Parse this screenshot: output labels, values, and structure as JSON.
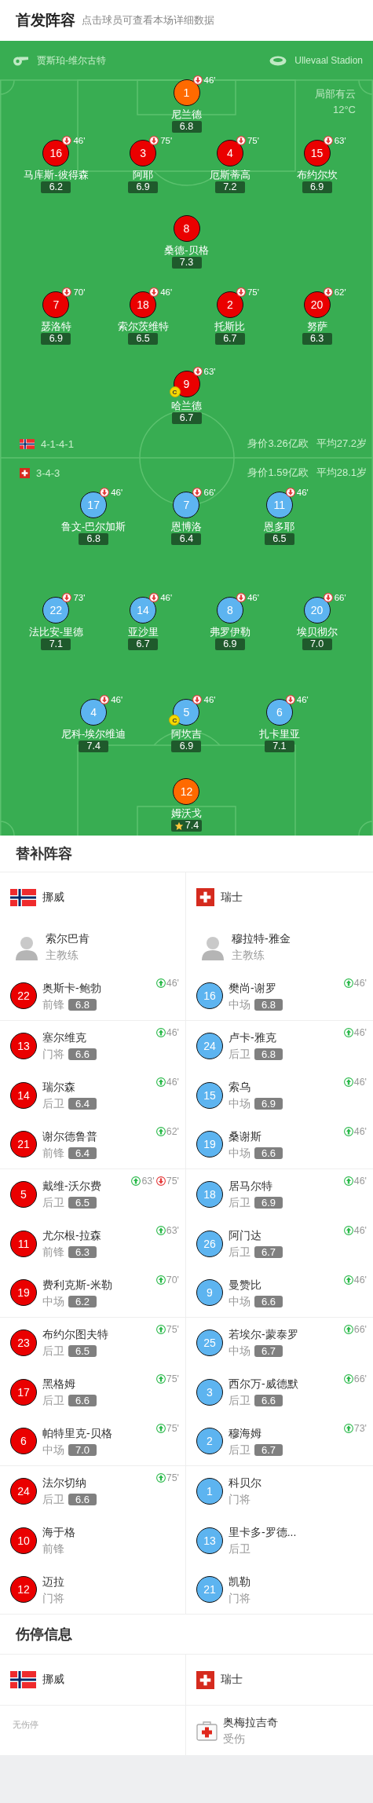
{
  "header": {
    "title": "首发阵容",
    "hint": "点击球员可查看本场详细数据"
  },
  "pitch": {
    "referee": "贾斯珀-维尔古特",
    "stadium": "Ullevaal Stadion",
    "weather": "局部有云",
    "temperature": "12°C",
    "home_rows": [
      [
        {
          "number": "1",
          "name": "尼兰德",
          "rating": "6.8",
          "off": "46'",
          "color": "#ff6a00",
          "best": false
        }
      ],
      [
        {
          "number": "16",
          "name": "马库斯-彼得森",
          "rating": "6.2",
          "off": "46'",
          "color": "#ea0000",
          "best": false
        },
        {
          "number": "3",
          "name": "阿耶",
          "rating": "6.9",
          "off": "75'",
          "color": "#ea0000",
          "best": false
        },
        {
          "number": "4",
          "name": "厄斯蒂高",
          "rating": "7.2",
          "off": "75'",
          "color": "#ea0000",
          "best": false
        },
        {
          "number": "15",
          "name": "布约尔坎",
          "rating": "6.9",
          "off": "63'",
          "color": "#ea0000",
          "best": false
        }
      ],
      [
        {
          "number": "8",
          "name": "桑德-贝格",
          "rating": "7.3",
          "color": "#ea0000",
          "best": false
        }
      ],
      [
        {
          "number": "7",
          "name": "瑟洛特",
          "rating": "6.9",
          "off": "70'",
          "color": "#ea0000",
          "best": false
        },
        {
          "number": "18",
          "name": "索尔茨维特",
          "rating": "6.5",
          "off": "46'",
          "color": "#ea0000",
          "best": false
        },
        {
          "number": "2",
          "name": "托斯比",
          "rating": "6.7",
          "off": "75'",
          "color": "#ea0000",
          "best": false
        },
        {
          "number": "20",
          "name": "努萨",
          "rating": "6.3",
          "off": "62'",
          "color": "#ea0000",
          "best": false
        }
      ],
      [
        {
          "number": "9",
          "name": "哈兰德",
          "rating": "6.7",
          "off": "63'",
          "captain": "C",
          "color": "#ea0000",
          "best": false
        }
      ]
    ],
    "formations": [
      {
        "formation": "4-1-4-1",
        "value": "身价3.26亿欧",
        "age": "平均27.2岁"
      },
      {
        "formation": "3-4-3",
        "value": "身价1.59亿欧",
        "age": "平均28.1岁"
      }
    ],
    "away_rows": [
      [
        {
          "number": "17",
          "name": "鲁文-巴尔加斯",
          "rating": "6.8",
          "off": "46'",
          "color": "#5db4f0",
          "best": false
        },
        {
          "number": "7",
          "name": "恩博洛",
          "rating": "6.4",
          "off": "66'",
          "color": "#5db4f0",
          "best": false
        },
        {
          "number": "11",
          "name": "恩多耶",
          "rating": "6.5",
          "off": "46'",
          "color": "#5db4f0",
          "best": false
        }
      ],
      [
        {
          "number": "22",
          "name": "法比安-里德",
          "rating": "7.1",
          "off": "73'",
          "color": "#5db4f0",
          "best": false
        },
        {
          "number": "14",
          "name": "亚沙里",
          "rating": "6.7",
          "off": "46'",
          "color": "#5db4f0",
          "best": false
        },
        {
          "number": "8",
          "name": "弗罗伊勒",
          "rating": "6.9",
          "off": "46'",
          "color": "#5db4f0",
          "best": false
        },
        {
          "number": "20",
          "name": "埃贝彻尔",
          "rating": "7.0",
          "off": "66'",
          "color": "#5db4f0",
          "best": false
        }
      ],
      [
        {
          "number": "4",
          "name": "尼科-埃尔维迪",
          "rating": "7.4",
          "off": "46'",
          "color": "#5db4f0",
          "best": false
        },
        {
          "number": "5",
          "name": "阿坎吉",
          "rating": "6.9",
          "off": "46'",
          "captain": "C",
          "color": "#5db4f0",
          "best": false
        },
        {
          "number": "6",
          "name": "扎卡里亚",
          "rating": "7.1",
          "off": "46'",
          "color": "#5db4f0",
          "best": false
        }
      ],
      [
        {
          "number": "12",
          "name": "姆沃戈",
          "rating": "7.4",
          "color": "#ff6a00",
          "best": true
        }
      ]
    ]
  },
  "bench": {
    "title": "替补阵容",
    "teams": [
      {
        "name": "挪威",
        "color": "#ea0000",
        "coach": {
          "name": "索尔巴肯",
          "role": "主教练"
        },
        "players": [
          {
            "number": "22",
            "name": "奥斯卡-鲍勃",
            "position": "前锋",
            "rating": "6.8",
            "sub_in": "46'"
          },
          {
            "number": "13",
            "name": "塞尔维克",
            "position": "门将",
            "rating": "6.6",
            "sub_in": "46'"
          },
          {
            "number": "14",
            "name": "瑞尔森",
            "position": "后卫",
            "rating": "6.4",
            "sub_in": "46'"
          },
          {
            "number": "21",
            "name": "谢尔德鲁普",
            "position": "前锋",
            "rating": "6.4",
            "sub_in": "62'"
          },
          {
            "number": "5",
            "name": "戴维-沃尔费",
            "position": "后卫",
            "rating": "6.5",
            "sub_in": "63'",
            "sub_off": "75'"
          },
          {
            "number": "11",
            "name": "尤尔根-拉森",
            "position": "前锋",
            "rating": "6.3",
            "sub_in": "63'"
          },
          {
            "number": "19",
            "name": "费利克斯-米勒",
            "position": "中场",
            "rating": "6.2",
            "sub_in": "70'"
          },
          {
            "number": "23",
            "name": "布约尔图夫特",
            "position": "后卫",
            "rating": "6.5",
            "sub_in": "75'"
          },
          {
            "number": "17",
            "name": "黑格姆",
            "position": "后卫",
            "rating": "6.6",
            "sub_in": "75'"
          },
          {
            "number": "6",
            "name": "帕特里克-贝格",
            "position": "中场",
            "rating": "7.0",
            "sub_in": "75'"
          },
          {
            "number": "24",
            "name": "法尔切纳",
            "position": "后卫",
            "rating": "6.6",
            "sub_in": "75'"
          },
          {
            "number": "10",
            "name": "海于格",
            "position": "前锋"
          },
          {
            "number": "12",
            "name": "迈拉",
            "position": "门将"
          }
        ]
      },
      {
        "name": "瑞士",
        "color": "#5db4f0",
        "coach": {
          "name": "穆拉特-雅金",
          "role": "主教练"
        },
        "players": [
          {
            "number": "16",
            "name": "樊尚-谢罗",
            "position": "中场",
            "rating": "6.8",
            "sub_in": "46'"
          },
          {
            "number": "24",
            "name": "卢卡-雅克",
            "position": "后卫",
            "rating": "6.8",
            "sub_in": "46'"
          },
          {
            "number": "15",
            "name": "索乌",
            "position": "中场",
            "rating": "6.9",
            "sub_in": "46'"
          },
          {
            "number": "19",
            "name": "桑谢斯",
            "position": "中场",
            "rating": "6.6",
            "sub_in": "46'"
          },
          {
            "number": "18",
            "name": "居马尔特",
            "position": "后卫",
            "rating": "6.9",
            "sub_in": "46'"
          },
          {
            "number": "26",
            "name": "阿门达",
            "position": "后卫",
            "rating": "6.7",
            "sub_in": "46'"
          },
          {
            "number": "9",
            "name": "曼赞比",
            "position": "中场",
            "rating": "6.6",
            "sub_in": "46'"
          },
          {
            "number": "25",
            "name": "若埃尔-蒙泰罗",
            "position": "中场",
            "rating": "6.7",
            "sub_in": "66'"
          },
          {
            "number": "3",
            "name": "西尔万-威德默",
            "position": "后卫",
            "rating": "6.6",
            "sub_in": "66'"
          },
          {
            "number": "2",
            "name": "穆海姆",
            "position": "后卫",
            "rating": "6.7",
            "sub_in": "73'"
          },
          {
            "number": "1",
            "name": "科贝尔",
            "position": "门将"
          },
          {
            "number": "13",
            "name": "里卡多-罗德...",
            "position": "后卫"
          },
          {
            "number": "21",
            "name": "凯勒",
            "position": "门将"
          }
        ]
      }
    ]
  },
  "injuries": {
    "title": "伤停信息",
    "teams": [
      {
        "name": "挪威",
        "none_text": "无伤停"
      },
      {
        "name": "瑞士",
        "players": [
          {
            "name": "奥梅拉吉奇",
            "status": "受伤"
          }
        ]
      }
    ]
  }
}
